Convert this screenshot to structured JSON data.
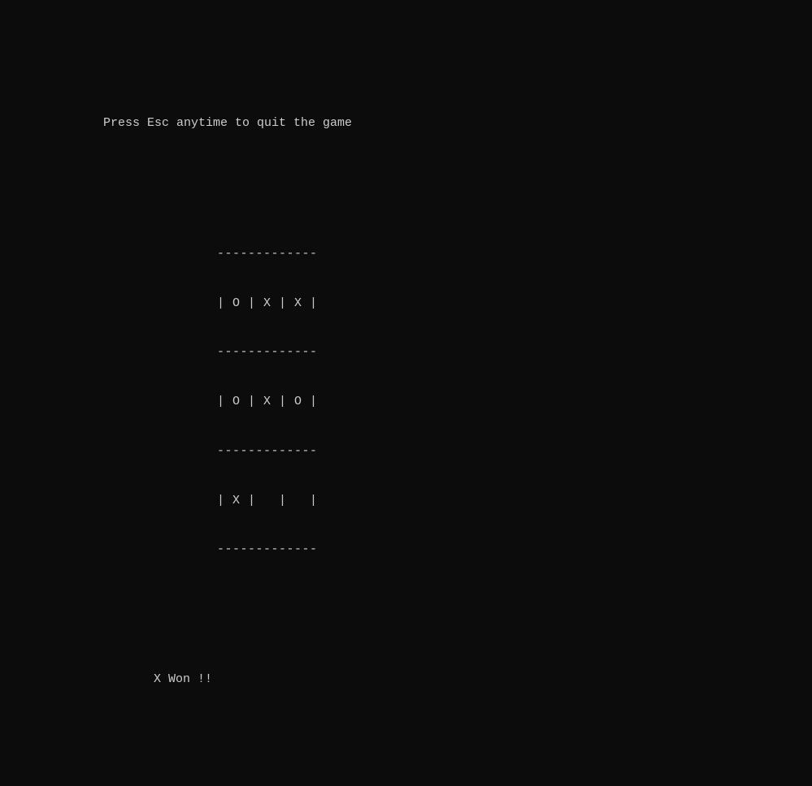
{
  "instruction": "Press Esc anytime to quit the game",
  "board": {
    "divider": "-------------",
    "rows": [
      "| O | X | X |",
      "| O | X | O |",
      "| X |   |   |"
    ]
  },
  "result": "X Won !!",
  "game_state": {
    "grid": [
      [
        "O",
        "X",
        "X"
      ],
      [
        "O",
        "X",
        "O"
      ],
      [
        "X",
        " ",
        " "
      ]
    ],
    "winner": "X"
  }
}
